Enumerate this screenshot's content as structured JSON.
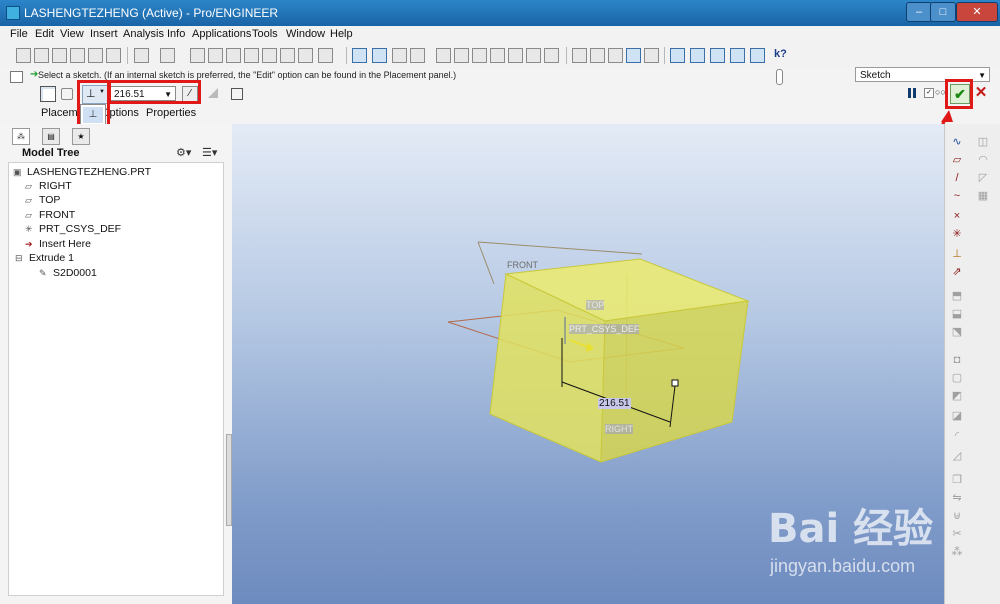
{
  "window": {
    "title": "LASHENGTEZHENG (Active) - Pro/ENGINEER",
    "minimize": "–",
    "maximize": "□",
    "close": "✕"
  },
  "menubar": [
    "File",
    "Edit",
    "View",
    "Insert",
    "Analysis",
    "Info",
    "Applications",
    "Tools",
    "Window",
    "Help"
  ],
  "toolbar": {
    "help": "k?"
  },
  "dashboard": {
    "message": "Select a sketch. (If an internal sketch is preferred, the \"Edit\" option can be found in the Placement panel.)",
    "message_arrow": "➔",
    "mode_select": "Sketch",
    "depth_value": "216.51",
    "flip_glyph": "⁄",
    "tabs": [
      "Placement",
      "Options",
      "Properties"
    ],
    "dropdown_items": [
      "⊥",
      "▯",
      "⊥"
    ],
    "ok_symbol": "✔",
    "cancel_symbol": "✕",
    "pause": "II",
    "glasses": "○○"
  },
  "model_tree": {
    "title": "Model Tree",
    "items": [
      {
        "icon": "part",
        "label": "LASHENGTEZHENG.PRT",
        "indent": 0
      },
      {
        "icon": "datum-plane",
        "label": "RIGHT",
        "indent": 1
      },
      {
        "icon": "datum-plane",
        "label": "TOP",
        "indent": 1
      },
      {
        "icon": "datum-plane",
        "label": "FRONT",
        "indent": 1
      },
      {
        "icon": "csys",
        "label": "PRT_CSYS_DEF",
        "indent": 1
      },
      {
        "icon": "insert-arrow",
        "label": "Insert Here",
        "indent": 1
      },
      {
        "icon": "extrude",
        "label": "Extrude 1",
        "indent": 1
      },
      {
        "icon": "sketch",
        "label": "S2D0001",
        "indent": 2
      }
    ]
  },
  "viewport": {
    "labels": {
      "front": "FRONT",
      "top": "TOP",
      "csys": "PRT_CSYS_DEF",
      "right": "RIGHT",
      "dimension": "216.51"
    }
  },
  "watermark": {
    "logo": "Bai 经验",
    "url": "jingyan.baidu.com"
  },
  "colors": {
    "accent_red": "#e01818",
    "model_yellow": "#dede5a",
    "viewport_top": "#e4ebf6",
    "viewport_bottom": "#6e8bbf"
  }
}
